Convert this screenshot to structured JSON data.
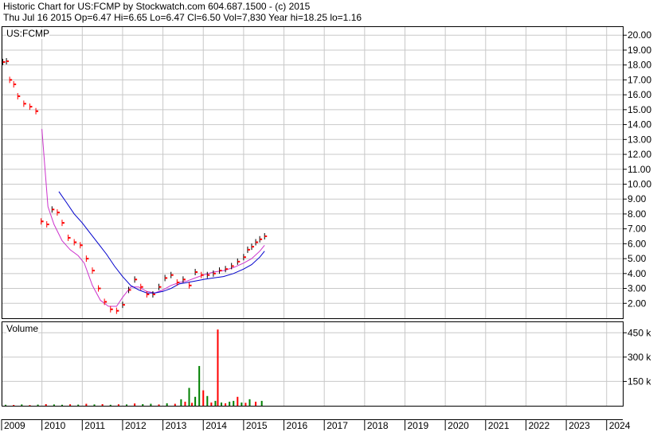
{
  "header": {
    "line1": "Historic Chart for US:FCMP by Stockwatch.com 604.687.1500 - (c) 2015",
    "line2": "Thu Jul 16 2015   Op=6.47   Hi=6.65   Lo=6.47   Cl=6.50   Vol=7,830   Year hi=18.25   lo=1.16"
  },
  "colors": {
    "grid": "#c8c8c8",
    "frame": "#000000",
    "price": "#ff0000",
    "price_dark": "#000000",
    "ma_short": "#cc33cc",
    "ma_long": "#0000cc",
    "volume_up": "#008000",
    "volume_down": "#ff0000"
  },
  "chart_data": [
    {
      "type": "line",
      "title": "US:FCMP",
      "yticks": [
        "20.00",
        "19.00",
        "18.00",
        "17.00",
        "16.00",
        "15.00",
        "14.00",
        "13.00",
        "12.00",
        "11.00",
        "10.00",
        "9.00",
        "8.00",
        "7.00",
        "6.00",
        "5.00",
        "4.00",
        "3.00",
        "2.00"
      ],
      "ylim": [
        1.0,
        20.6
      ],
      "xlim": [
        2009.0,
        2024.4
      ],
      "series": [
        {
          "role": "price",
          "x": [
            2009.03,
            2009.12,
            2009.2,
            2009.3,
            2009.4,
            2009.55,
            2009.7,
            2009.85,
            2009.98,
            2010.12,
            2010.25,
            2010.38,
            2010.5,
            2010.65,
            2010.8,
            2010.95,
            2011.1,
            2011.25,
            2011.4,
            2011.55,
            2011.7,
            2011.85,
            2012.0,
            2012.15,
            2012.3,
            2012.45,
            2012.6,
            2012.75,
            2012.9,
            2013.05,
            2013.2,
            2013.35,
            2013.5,
            2013.65,
            2013.8,
            2013.95,
            2014.1,
            2014.25,
            2014.4,
            2014.55,
            2014.7,
            2014.85,
            2015.0,
            2015.1,
            2015.2,
            2015.3,
            2015.4,
            2015.52
          ],
          "y": [
            18.2,
            18.25,
            17.0,
            16.7,
            15.9,
            15.4,
            15.2,
            14.9,
            7.5,
            7.3,
            8.3,
            8.1,
            7.4,
            6.4,
            6.1,
            5.9,
            5.0,
            4.2,
            3.0,
            2.1,
            1.6,
            1.5,
            1.9,
            2.9,
            3.6,
            3.1,
            2.6,
            2.6,
            3.1,
            3.7,
            3.9,
            3.4,
            3.6,
            3.2,
            4.1,
            3.9,
            3.9,
            4.0,
            4.2,
            4.3,
            4.5,
            4.8,
            5.1,
            5.6,
            5.8,
            6.1,
            6.3,
            6.5
          ]
        },
        {
          "role": "ma_short",
          "x": [
            2010.0,
            2010.15,
            2010.3,
            2010.5,
            2010.7,
            2010.9,
            2011.05,
            2011.25,
            2011.45,
            2011.65,
            2011.85,
            2012.0,
            2012.2,
            2012.4,
            2012.6,
            2012.8,
            2013.0,
            2013.2,
            2013.4,
            2013.6,
            2013.8,
            2014.0,
            2014.25,
            2014.5,
            2014.75,
            2015.0,
            2015.2,
            2015.4,
            2015.52
          ],
          "y": [
            13.7,
            8.5,
            7.3,
            6.2,
            5.6,
            5.2,
            4.7,
            3.2,
            2.2,
            1.8,
            1.8,
            2.4,
            3.1,
            3.1,
            2.8,
            2.7,
            2.9,
            3.2,
            3.4,
            3.5,
            3.7,
            3.9,
            4.1,
            4.2,
            4.4,
            4.7,
            5.0,
            5.5,
            5.9
          ]
        },
        {
          "role": "ma_long",
          "x": [
            2010.42,
            2010.6,
            2010.8,
            2011.0,
            2011.2,
            2011.4,
            2011.6,
            2011.8,
            2012.0,
            2012.2,
            2012.4,
            2012.6,
            2012.8,
            2013.0,
            2013.2,
            2013.4,
            2013.6,
            2013.8,
            2014.0,
            2014.25,
            2014.5,
            2014.75,
            2015.0,
            2015.2,
            2015.4,
            2015.52
          ],
          "y": [
            9.5,
            8.8,
            8.0,
            7.4,
            6.7,
            6.0,
            5.3,
            4.5,
            3.8,
            3.2,
            2.9,
            2.7,
            2.7,
            2.8,
            3.0,
            3.3,
            3.4,
            3.5,
            3.6,
            3.7,
            3.8,
            4.0,
            4.3,
            4.6,
            5.1,
            5.5
          ]
        }
      ],
      "xticks": [
        "2009",
        "2010",
        "2011",
        "2012",
        "2013",
        "2014",
        "2015",
        "2016",
        "2017",
        "2018",
        "2019",
        "2020",
        "2021",
        "2022",
        "2023",
        "2024"
      ]
    },
    {
      "type": "bar",
      "title": "Volume",
      "yticks": [
        "450 k",
        "300 k",
        "150 k"
      ],
      "ylim": [
        0,
        520
      ],
      "xlim": [
        2009.0,
        2024.4
      ],
      "x": [
        2009.1,
        2009.3,
        2009.5,
        2009.7,
        2009.9,
        2010.1,
        2010.3,
        2010.5,
        2010.7,
        2010.9,
        2011.1,
        2011.3,
        2011.5,
        2011.7,
        2011.9,
        2012.1,
        2012.3,
        2012.5,
        2012.7,
        2012.9,
        2013.1,
        2013.3,
        2013.45,
        2013.55,
        2013.65,
        2013.72,
        2013.8,
        2013.9,
        2014.0,
        2014.1,
        2014.2,
        2014.3,
        2014.36,
        2014.45,
        2014.55,
        2014.65,
        2014.75,
        2014.85,
        2014.95,
        2015.05,
        2015.15,
        2015.3,
        2015.45
      ],
      "values": [
        6,
        5,
        8,
        4,
        7,
        10,
        8,
        6,
        9,
        7,
        12,
        8,
        10,
        6,
        9,
        8,
        14,
        10,
        12,
        8,
        15,
        12,
        40,
        25,
        110,
        18,
        55,
        245,
        95,
        60,
        20,
        30,
        470,
        20,
        15,
        25,
        30,
        55,
        20,
        18,
        40,
        25,
        30
      ],
      "colors": [
        "g",
        "r",
        "g",
        "r",
        "g",
        "r",
        "g",
        "g",
        "r",
        "g",
        "r",
        "g",
        "r",
        "g",
        "r",
        "g",
        "r",
        "g",
        "g",
        "r",
        "g",
        "r",
        "g",
        "r",
        "g",
        "r",
        "g",
        "g",
        "r",
        "g",
        "r",
        "g",
        "r",
        "g",
        "r",
        "g",
        "g",
        "r",
        "g",
        "r",
        "g",
        "r",
        "g"
      ]
    }
  ]
}
